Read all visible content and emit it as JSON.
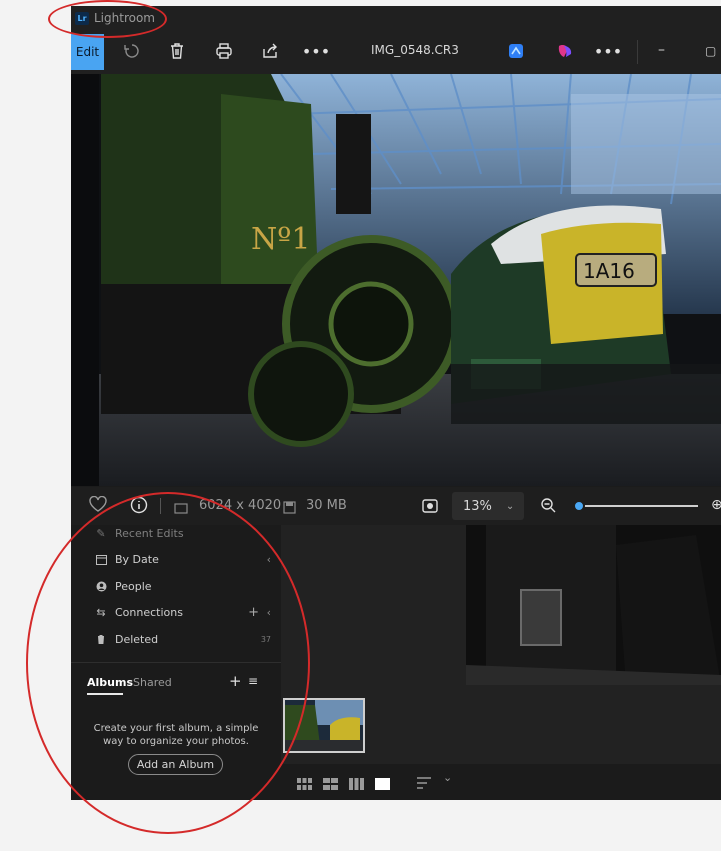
{
  "titlebar": {
    "logo": "Lr",
    "app_name": "Lightroom"
  },
  "toolbar": {
    "edit_label": "Edit",
    "filename": "IMG_0548.CR3",
    "icons": [
      "rotate-icon",
      "trash-icon",
      "print-icon",
      "share-icon",
      "more-icon",
      "photoshop-express-icon",
      "copilot-icon",
      "more-icon"
    ]
  },
  "infobar": {
    "dimensions": "6024 x 4020",
    "file_size": "30 MB",
    "zoom": "13%"
  },
  "sidebar": {
    "items": [
      {
        "label": "Recent Edits",
        "icon": "recent-icon"
      },
      {
        "label": "By Date",
        "icon": "calendar-icon"
      },
      {
        "label": "People",
        "icon": "person-icon"
      },
      {
        "label": "Connections",
        "icon": "connections-icon"
      },
      {
        "label": "Deleted",
        "icon": "trash-icon",
        "count": "37"
      }
    ],
    "tabs": {
      "albums": "Albums",
      "shared": "Shared"
    },
    "album_message": "Create your first album, a simple way to organize your photos.",
    "add_album_label": "Add an Album"
  },
  "colors": {
    "accent": "#49a4f2",
    "annotation": "#d42a2a"
  }
}
